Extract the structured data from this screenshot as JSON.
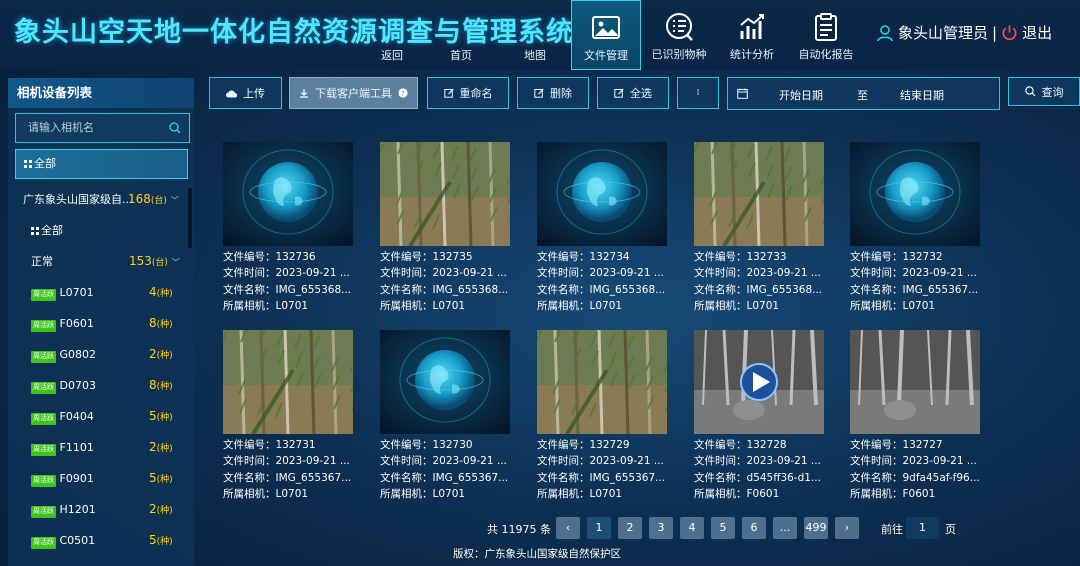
{
  "app": {
    "title": "象头山空天地一体化自然资源调查与管理系统"
  },
  "nav": {
    "back": "返回",
    "home": "首页",
    "map": "地图",
    "items": [
      {
        "label": "文件管理",
        "icon": "image-icon",
        "active": true
      },
      {
        "label": "已识别物种",
        "icon": "checklist-icon",
        "active": false
      },
      {
        "label": "统计分析",
        "icon": "bar-chart-icon",
        "active": false
      },
      {
        "label": "自动化报告",
        "icon": "report-icon",
        "active": false
      }
    ]
  },
  "user": {
    "name": "象头山管理员",
    "separator": "|",
    "logout": "退出"
  },
  "sidebar": {
    "title": "相机设备列表",
    "search_placeholder": "请输入相机名",
    "all_label": "全部",
    "group_name": "广东象头山国家级自...",
    "group_count": "168",
    "group_all": "全部",
    "status_label": "正常",
    "status_count": "153",
    "unit": "(台)",
    "unit_species": "(种)",
    "tag": "周活跃",
    "cameras": [
      {
        "name": "L0701",
        "count": "4"
      },
      {
        "name": "F0601",
        "count": "8"
      },
      {
        "name": "G0802",
        "count": "2"
      },
      {
        "name": "D0703",
        "count": "8"
      },
      {
        "name": "F0404",
        "count": "5"
      },
      {
        "name": "F1101",
        "count": "2"
      },
      {
        "name": "F0901",
        "count": "5"
      },
      {
        "name": "H1201",
        "count": "2"
      },
      {
        "name": "C0501",
        "count": "5"
      }
    ]
  },
  "toolbar": {
    "upload": "上传",
    "download_client": "下载客户端工具",
    "rename": "重命名",
    "delete": "删除",
    "select_all": "全选",
    "date_start": "开始日期",
    "date_to": "至",
    "date_end": "结束日期",
    "query": "查询"
  },
  "labels": {
    "file_no": "文件编号：",
    "file_time": "文件时间：",
    "file_name": "文件名称：",
    "camera": "所属相机："
  },
  "files": [
    {
      "no": "132736",
      "time": "2023-09-21 ...",
      "name": "IMG_655368...",
      "camera": "L0701",
      "thumb": "globe"
    },
    {
      "no": "132735",
      "time": "2023-09-21 ...",
      "name": "IMG_655368...",
      "camera": "L0701",
      "thumb": "forest"
    },
    {
      "no": "132734",
      "time": "2023-09-21 ...",
      "name": "IMG_655368...",
      "camera": "L0701",
      "thumb": "globe"
    },
    {
      "no": "132733",
      "time": "2023-09-21 ...",
      "name": "IMG_655368...",
      "camera": "L0701",
      "thumb": "forest"
    },
    {
      "no": "132732",
      "time": "2023-09-21 ...",
      "name": "IMG_655367...",
      "camera": "L0701",
      "thumb": "globe"
    },
    {
      "no": "132731",
      "time": "2023-09-21 ...",
      "name": "IMG_655367...",
      "camera": "L0701",
      "thumb": "forest"
    },
    {
      "no": "132730",
      "time": "2023-09-21 ...",
      "name": "IMG_655367...",
      "camera": "L0701",
      "thumb": "globe"
    },
    {
      "no": "132729",
      "time": "2023-09-21 ...",
      "name": "IMG_655367...",
      "camera": "L0701",
      "thumb": "forest"
    },
    {
      "no": "132728",
      "time": "2023-09-21 ...",
      "name": "d545ff36-d1...",
      "camera": "F0601",
      "thumb": "night-video"
    },
    {
      "no": "132727",
      "time": "2023-09-21 ...",
      "name": "9dfa45af-f96...",
      "camera": "F0601",
      "thumb": "night"
    }
  ],
  "pagination": {
    "total_label": "共 11975 条",
    "pages": [
      "1",
      "2",
      "3",
      "4",
      "5",
      "6",
      "...",
      "499"
    ],
    "current": "1",
    "goto_label": "前往",
    "goto_value": "1",
    "page_suffix": "页"
  },
  "footer": {
    "copyright": "版权：广东象头山国家级自然保护区"
  },
  "colors": {
    "accent": "#2fd3f0",
    "title": "#4fe6ff",
    "count": "#ffd21a",
    "tag": "#3ec21c",
    "logout": "#ff4b4b"
  }
}
